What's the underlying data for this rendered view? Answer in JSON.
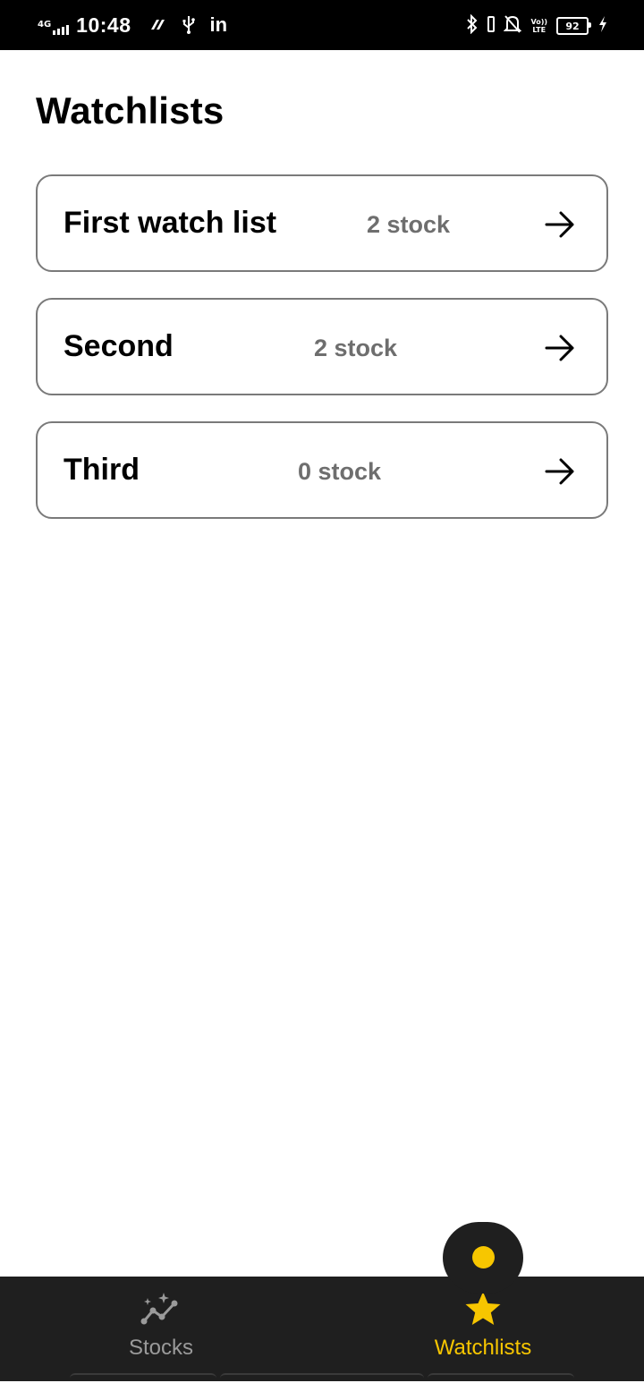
{
  "status_bar": {
    "network": "4G",
    "time": "10:48",
    "linkedin_label": "in",
    "volte_top": "Vo))",
    "volte_bottom": "LTE",
    "battery_level": "92"
  },
  "page": {
    "title": "Watchlists"
  },
  "watchlists": [
    {
      "name": "First watch list",
      "count": "2 stock"
    },
    {
      "name": "Second",
      "count": "2 stock"
    },
    {
      "name": "Third",
      "count": "0 stock"
    }
  ],
  "bottom_nav": {
    "tabs": [
      {
        "label": "Stocks",
        "icon": "stocks-chart-icon",
        "active": false
      },
      {
        "label": "Watchlists",
        "icon": "star-icon",
        "active": true
      }
    ]
  },
  "colors": {
    "accent": "#f7c600",
    "nav_background": "#1f1f1f",
    "card_border": "#7a7a7a",
    "muted_text": "#6e6e6e",
    "inactive_nav": "#9a9a9a"
  }
}
